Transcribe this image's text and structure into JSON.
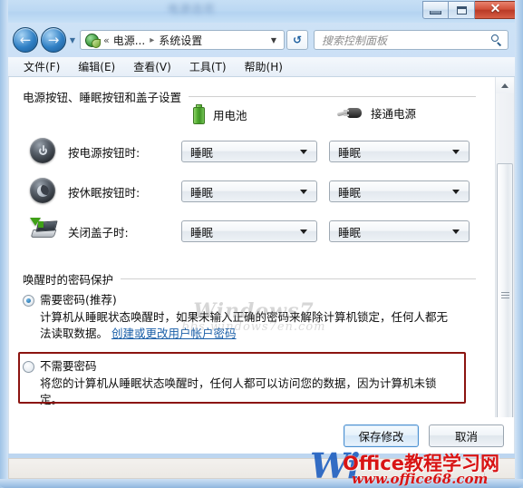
{
  "window": {
    "title_blurred": "电源选项",
    "controls": {
      "minimize": "–",
      "maximize": "□",
      "close": "✕"
    }
  },
  "nav": {
    "back_arrow": "←",
    "forward_arrow": "→",
    "history_caret": "▼",
    "breadcrumb": {
      "chevrons": "«",
      "segments": [
        "电源...",
        "系统设置"
      ],
      "separator": "▸",
      "dropdown_caret": "▼"
    },
    "refresh_label": "↺",
    "search_placeholder": "搜索控制面板"
  },
  "menubar": {
    "items": [
      "文件(F)",
      "编辑(E)",
      "查看(V)",
      "工具(T)",
      "帮助(H)"
    ]
  },
  "power_section": {
    "heading": "电源按钮、睡眠按钮和盖子设置",
    "columns": [
      {
        "label": "用电池",
        "icon": "battery-icon"
      },
      {
        "label": "接通电源",
        "icon": "power-plug-icon"
      }
    ],
    "rows": [
      {
        "icon": "power-button-icon",
        "label": "按电源按钮时:",
        "battery_value": "睡眠",
        "plugged_value": "睡眠"
      },
      {
        "icon": "sleep-moon-icon",
        "label": "按休眠按钮时:",
        "battery_value": "睡眠",
        "plugged_value": "睡眠"
      },
      {
        "icon": "laptop-lid-icon",
        "label": "关闭盖子时:",
        "battery_value": "睡眠",
        "plugged_value": "睡眠"
      }
    ]
  },
  "password_section": {
    "heading": "唤醒时的密码保护",
    "options": [
      {
        "selected": true,
        "title": "需要密码(推荐)",
        "description": "计算机从睡眠状态唤醒时，如果未输入正确的密码来解除计算机锁定，任何人都无法读取数据。",
        "link": "创建或更改用户帐户密码"
      },
      {
        "selected": false,
        "title": "不需要密码",
        "description": "将您的计算机从睡眠状态唤醒时，任何人都可以访问您的数据，因为计算机未锁定。",
        "link": ""
      }
    ],
    "highlight_color": "#8b1410"
  },
  "buttons": {
    "save": "保存修改",
    "cancel": "取消"
  },
  "watermarks": {
    "center_line1": "Windows7",
    "center_line2": "bbs.windows7en.com",
    "bottom_prefix": "Wi",
    "bottom_cn": "Office教程学习网",
    "bottom_url": "www.office68.com"
  },
  "colors": {
    "accent_blue": "#1b5fa8",
    "highlight_red": "#8b1410",
    "watermark_red": "#d81414",
    "battery_green": "#4faa2e"
  }
}
